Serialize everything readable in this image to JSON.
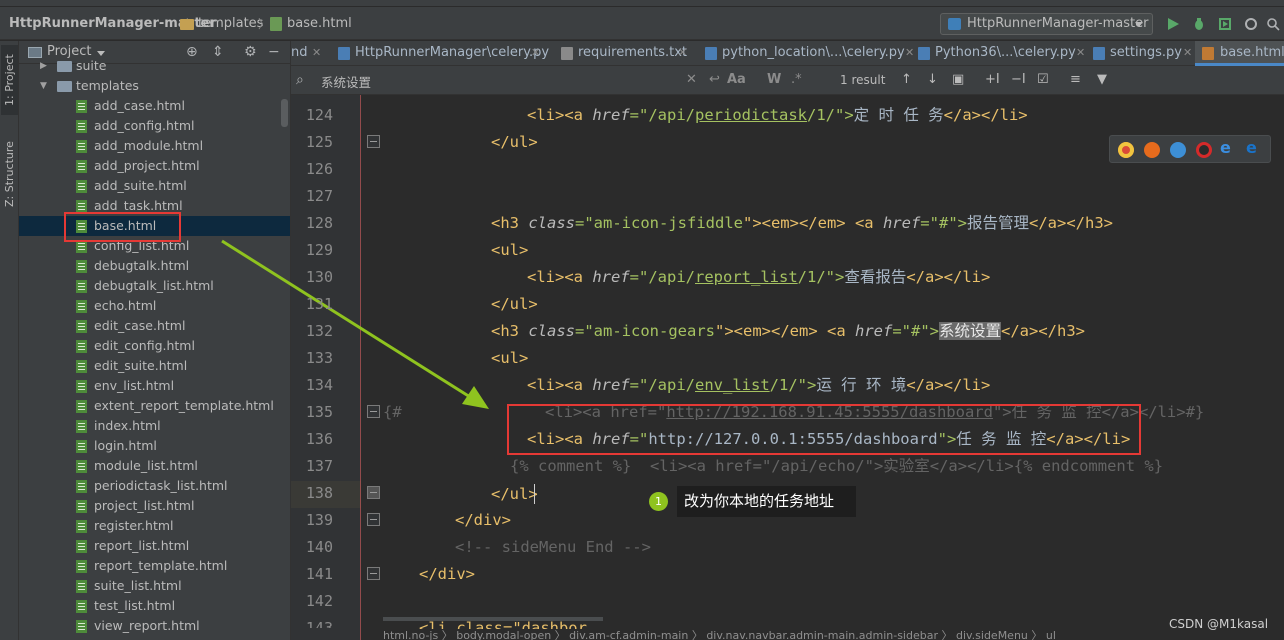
{
  "breadcrumb": {
    "project": "HttpRunnerManager-master",
    "folder": "templates",
    "file": "base.html"
  },
  "run_config": {
    "label": "HttpRunnerManager-master"
  },
  "side_tabs": {
    "project": "1: Project",
    "structure": "Z: Structure"
  },
  "project_panel": {
    "title": "Project",
    "tree": {
      "suite_folder": "suite",
      "templates_folder": "templates",
      "files": [
        "add_case.html",
        "add_config.html",
        "add_module.html",
        "add_project.html",
        "add_suite.html",
        "add_task.html",
        "base.html",
        "config_list.html",
        "debugtalk.html",
        "debugtalk_list.html",
        "echo.html",
        "edit_case.html",
        "edit_config.html",
        "edit_suite.html",
        "env_list.html",
        "extent_report_template.html",
        "index.html",
        "login.html",
        "module_list.html",
        "periodictask_list.html",
        "project_list.html",
        "register.html",
        "report_list.html",
        "report_template.html",
        "suite_list.html",
        "test_list.html",
        "view_report.html"
      ],
      "selected": "base.html"
    }
  },
  "tabs": [
    {
      "label": "nd",
      "active": false
    },
    {
      "label": "HttpRunnerManager\\celery.py",
      "active": false
    },
    {
      "label": "requirements.txt",
      "active": false
    },
    {
      "label": "python_location\\...\\celery.py",
      "active": false
    },
    {
      "label": "Python36\\...\\celery.py",
      "active": false
    },
    {
      "label": "settings.py",
      "active": false
    },
    {
      "label": "base.html",
      "active": true
    }
  ],
  "find": {
    "query": "系统设置",
    "result": "1 result"
  },
  "editor": {
    "line_numbers": [
      "124",
      "125",
      "126",
      "127",
      "128",
      "129",
      "130",
      "131",
      "132",
      "133",
      "134",
      "135",
      "136",
      "137",
      "138",
      "139",
      "140",
      "141",
      "142",
      "143"
    ],
    "lines": {
      "l124": {
        "open": "<li><a ",
        "attr": "href",
        "eq": "=\"",
        "val1": "/api/",
        "val2": "periodictask",
        "val3": "/1/",
        "close_q": "\">",
        "text": "定 时 任 务",
        "end": "</a></li>"
      },
      "l125": "</ul>",
      "l128": {
        "open": "<h3 ",
        "attr": "class",
        "eq": "=\"",
        "val": "am-icon-jsfiddle",
        "mid": "\"><em></em> <a ",
        "attr2": "href",
        "eq2": "=\"",
        "val2": "#",
        "close_q": "\">",
        "text": "报告管理",
        "end": "</a></h3>"
      },
      "l129": "<ul>",
      "l130": {
        "open": "<li><a ",
        "attr": "href",
        "eq": "=\"",
        "val1": "/api/",
        "val2": "report_list",
        "val3": "/1/",
        "close_q": "\">",
        "text": "查看报告",
        "end": "</a></li>"
      },
      "l131": "</ul>",
      "l132": {
        "open": "<h3 ",
        "attr": "class",
        "eq": "=\"",
        "val": "am-icon-gears",
        "mid": "\"><em></em> <a ",
        "attr2": "href",
        "eq2": "=\"",
        "val2": "#",
        "close_q": "\">",
        "text": "系统设置",
        "end": "</a></h3>"
      },
      "l133": "<ul>",
      "l134": {
        "open": "<li><a ",
        "attr": "href",
        "eq": "=\"",
        "val1": "/api/",
        "val2": "env_list",
        "val3": "/1/",
        "close_q": "\">",
        "text": "运 行 环 境",
        "end": "</a></li>"
      },
      "l135": {
        "prefix": "{#",
        "comment_a": "<li><a href=\"",
        "url": "http://192.168.91.45:5555/dashboard",
        "comment_b": "\">任 务 监 控</a></li>#}"
      },
      "l136": {
        "open": "<li><a ",
        "attr": "href",
        "eq": "=\"",
        "val": "http://127.0.0.1:5555/dashboard",
        "close_q": "\">",
        "text": "任 务 监 控",
        "end": "</a></li>"
      },
      "l137": "{% comment %}  <li><a href=\"/api/echo/\">实验室</a></li>{% endcomment %}",
      "l138": "</ul>",
      "l139": "</div>",
      "l140": "<!-- sideMenu End -->",
      "l141": "</div>",
      "l143": "<li class=\"dashbor"
    }
  },
  "annotation": {
    "step": "1",
    "text": "改为你本地的任务地址"
  },
  "bottom_breadcrumb": "html.no-js  〉 body.modal-open  〉 div.am-cf.admin-main  〉 div.nav.navbar.admin-main.admin-sidebar  〉 div.sideMenu  〉 ul",
  "watermark": "CSDN @M1kasal",
  "colors": {
    "accent": "#4a88c7",
    "annotation_red": "#e53935",
    "arrow_green": "#8fc31f",
    "selection": "#0d293e"
  }
}
